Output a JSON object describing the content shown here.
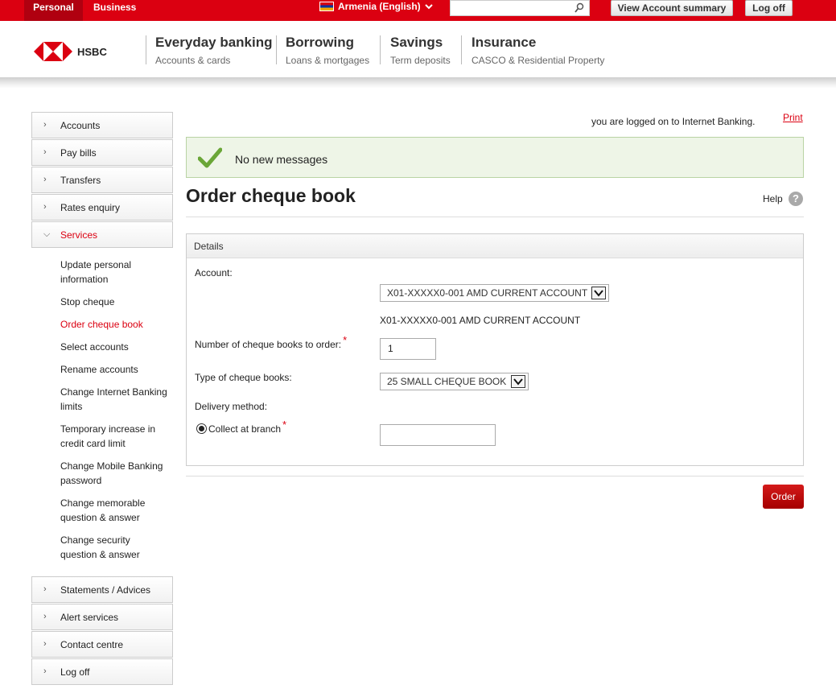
{
  "topbar": {
    "personal": "Personal",
    "business": "Business",
    "language": "Armenia (English)",
    "search_placeholder": "",
    "view_summary": "View Account summary",
    "log_off": "Log off"
  },
  "header": {
    "brand": "HSBC",
    "nav": [
      {
        "title": "Everyday banking",
        "sub": "Accounts & cards"
      },
      {
        "title": "Borrowing",
        "sub": "Loans & mortgages"
      },
      {
        "title": "Savings",
        "sub": "Term deposits"
      },
      {
        "title": "Insurance",
        "sub": "CASCO & Residential Property"
      }
    ]
  },
  "sidebar": {
    "top": [
      "Accounts",
      "Pay bills",
      "Transfers",
      "Rates enquiry"
    ],
    "open": "Services",
    "sub": [
      "Update personal information",
      "Stop cheque",
      "Order cheque book",
      "Select accounts",
      "Rename accounts",
      "Change Internet Banking limits",
      "Temporary increase in credit card limit",
      "Change Mobile Banking password",
      "Change memorable question & answer",
      "Change security question & answer"
    ],
    "bottom": [
      "Statements / Advices",
      "Alert services",
      "Contact centre",
      "Log off"
    ]
  },
  "main": {
    "logged_on": "you are logged on to Internet Banking.",
    "print": "Print",
    "message": "No new messages",
    "title": "Order cheque book",
    "help": "Help",
    "help_icon": "?"
  },
  "form": {
    "section": "Details",
    "account_label": "Account:",
    "account_selected": "X01-XXXXX0-001 AMD CURRENT ACCOUNT",
    "account_display": "X01-XXXXX0-001 AMD CURRENT ACCOUNT",
    "number_label": "Number of cheque books to order:",
    "number_value": "1",
    "type_label": "Type of cheque books:",
    "type_selected": "25 SMALL CHEQUE BOOK",
    "delivery_label": "Delivery method:",
    "collect_label": "Collect at branch",
    "branch_value": "",
    "required_mark": "*",
    "order_button": "Order"
  },
  "colors": {
    "brand_red": "#db0011",
    "success_bg": "#eef5e7"
  }
}
